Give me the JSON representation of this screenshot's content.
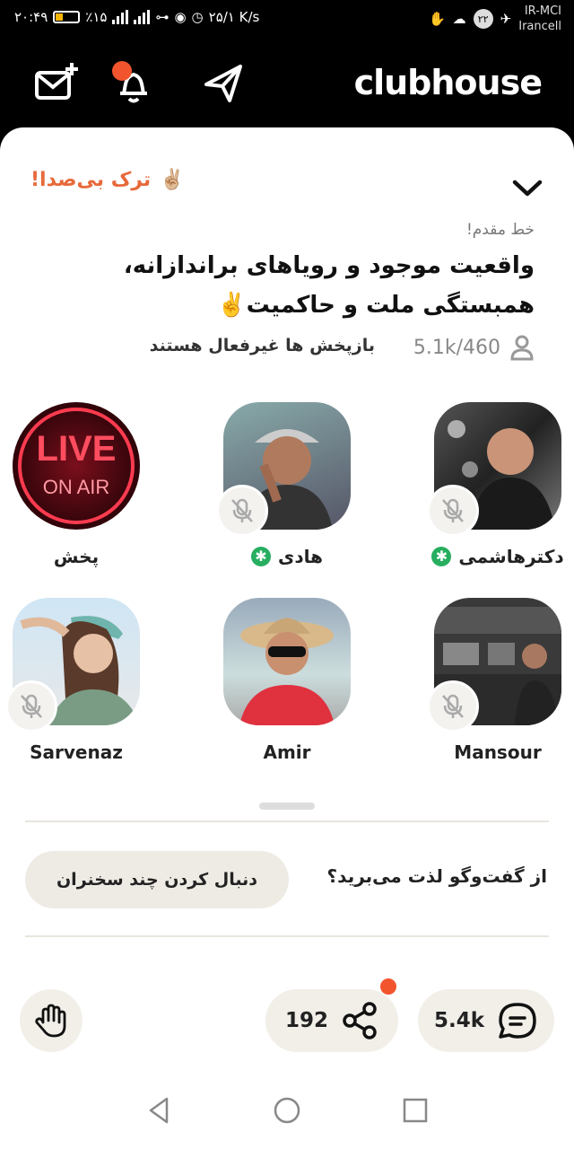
{
  "status_bar": {
    "time": "۲۰:۴۹",
    "battery": "٪۱۵",
    "speed": "۲۵/۱ K/s",
    "notification_badge": "۲۲",
    "carrier_top": "IR-MCI",
    "carrier_bottom": "Irancell"
  },
  "header": {
    "logo": "clubhouse",
    "icons": [
      "invite-mail-icon",
      "notification-bell-icon",
      "send-icon"
    ]
  },
  "room": {
    "leave_label": "ترک بی‌صدا!",
    "club_label": "خط مقدم!",
    "title": "واقعیت موجود و رویاهای براندازانه، همبستگی ملت و حاکمیت✌️",
    "listener_count": "5.1k/460",
    "replay_status": "بازپخش ها غیرفعال هستند"
  },
  "speakers": [
    {
      "name": "دکترهاشمی",
      "moderator": true,
      "muted": true
    },
    {
      "name": "هادی",
      "moderator": true,
      "muted": true
    },
    {
      "name": "پخش",
      "moderator": false,
      "muted": false,
      "avatar_text_1": "LIVE",
      "avatar_text_2": "ON AIR"
    },
    {
      "name": "Mansour",
      "moderator": false,
      "muted": true
    },
    {
      "name": "Amir",
      "moderator": false,
      "muted": false
    },
    {
      "name": "Sarvenaz",
      "moderator": false,
      "muted": true
    }
  ],
  "follow": {
    "question": "از گفت‌وگو لذت می‌برید؟",
    "button": "دنبال کردن چند سخنران"
  },
  "actions": {
    "share_count": "192",
    "chat_count": "5.4k"
  },
  "colors": {
    "accent": "#e76a3c",
    "moderator": "#27ae60",
    "notification_dot": "#f2552e",
    "pill_bg": "#f1efe8"
  }
}
